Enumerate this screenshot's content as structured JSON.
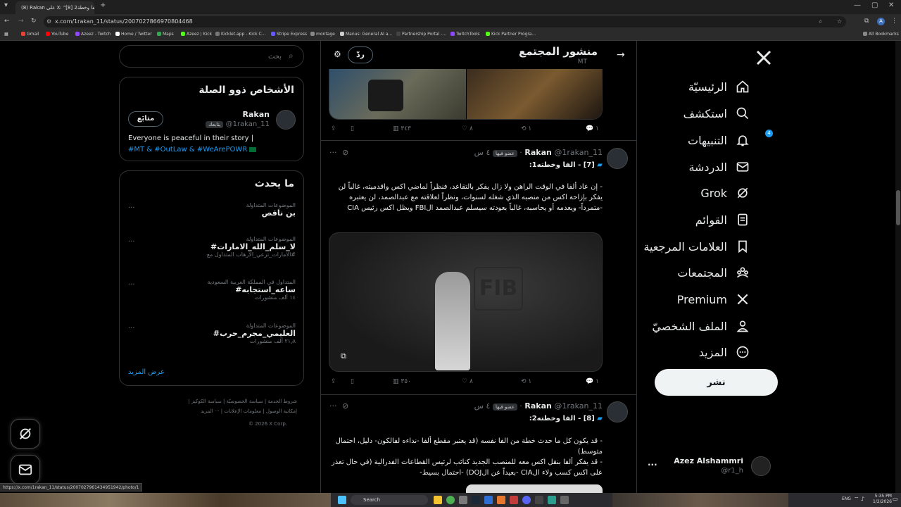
{
  "browser": {
    "tab_title": "(8) Rakan على X: \"[8] الفا وخطة2",
    "url": "x.com/1rakan_11/status/2007027866970804468",
    "status_url": "https://x.com/1rakan_11/status/2007027961434951942/photo/1",
    "bookmarks": [
      "Gmail",
      "YouTube",
      "Azeez - Twitch",
      "Home / Twitter",
      "Maps",
      "Azeez | Kick",
      "Kicklet.app - Kick C...",
      "Stripe Express",
      "montage",
      "Manus: General AI a...",
      "Partnership Portal -...",
      "TwitchTools",
      "Kick Partner Progra..."
    ],
    "all_bookmarks": "All Bookmarks"
  },
  "nav": {
    "items": [
      "الرئيسيّة",
      "استكشف",
      "التنبيهات",
      "الدردشة",
      "Grok",
      "القوائم",
      "العلامات المرجعية",
      "المجتمعات",
      "Premium",
      "الملف الشخصيّ",
      "المزيد"
    ],
    "notif_badge": "4",
    "post_button": "نشر",
    "account_name": "Azez Alshammri",
    "account_handle": "@r1_h",
    "account_more": "..."
  },
  "header": {
    "title": "منشور المجتمع",
    "subtitle": "MT",
    "reply_button": "ردّ"
  },
  "tweet1_actions": {
    "replies": "١",
    "retweets": "١",
    "likes": "٨",
    "views": "٣٤٣"
  },
  "tweet2": {
    "author": "Rakan",
    "handle": "@1rakan_11",
    "badge": "عضو فيها",
    "time": "٤ س",
    "title": "[7] - الفا وخطته1:",
    "text": "- إن عاد ألفا في الوقت الراهن ولا زال يفكر بالتقاعد، فنظراً لماضي اكس واقدميته، غالباً لن يفكر بإزاحة اكس من منصبه الذي شغله لسنوات، ونظراً لعلاقته مع عبدالصمد، لن يعتبره -متمرداً- ويعدمه أو يحاسبه، غالباً بعودته سيسلم عبدالصمد الFBI ويظل اكس رئيس CIA",
    "actions": {
      "replies": "١",
      "retweets": "١",
      "likes": "٨",
      "views": "٣٥٠"
    }
  },
  "tweet3": {
    "author": "Rakan",
    "handle": "@1rakan_11",
    "badge": "عضو فيها",
    "time": "٤ س",
    "title": "[8] - الفا وخطته2:",
    "text": "- قد يكون كل ما حدث خطة من الفا نفسه (قد يعتبر مقطع ألفا -نداءه لفالكون- دليل، احتمال متوسط)\n- قد يفكر ألفا بنقل اكس معه للمنصب الجديد كنائب لرئيس القطاعات الفدرالية (في حال تعذر على اكس كسب ولاء الCIA -بعيداً عن الDOJ) -احتمال بسيط-"
  },
  "search": {
    "placeholder": "بحث"
  },
  "related": {
    "title": "الأشخاص ذوو الصلة",
    "name": "Rakan",
    "handle": "@1rakan_11",
    "follows_you": "يتابعك",
    "follow_button": "متابَع",
    "bio_text": "Everyone is peaceful in their story |",
    "bio_tags": "#MT & #OutLaw & #WeArePOWR"
  },
  "trending": {
    "title": "ما يحدث",
    "items": [
      {
        "category": "الموضوعات المتداولة",
        "name": "بن ناقص",
        "count": "",
        "more": "..."
      },
      {
        "category": "الموضوعات المتداولة",
        "name": "#لا_سلم_الله_الامارات",
        "count": "#الامارات_ترعي_الارهاب المتداول مع",
        "more": "..."
      },
      {
        "category": "المتداول في المملكة العربية السعودية",
        "name": "#ساعه_استجابه",
        "count": "١٤ ألف منشورات",
        "more": "..."
      },
      {
        "category": "الموضوعات المتداولة",
        "name": "#العليمي_مجرم_حرب",
        "count": "٢١٫٨ ألف منشورات",
        "more": "..."
      }
    ],
    "show_more": "عرض المزيد"
  },
  "footer": {
    "links": [
      "شروط الخدمة",
      "سياسة الخصوصيّة",
      "سياسة الكوكيز",
      "إمكانية الوصول",
      "معلومات الإعلانات",
      "··· المزيد"
    ],
    "copyright": "© 2026 X Corp."
  },
  "taskbar": {
    "search": "Search",
    "lang": "ENG",
    "time": "5:35 PM",
    "date": "1/2/2026"
  },
  "colors": {
    "accent": "#1d9bf0",
    "bg": "#000000",
    "border": "#2f3336",
    "muted": "#71767b"
  }
}
